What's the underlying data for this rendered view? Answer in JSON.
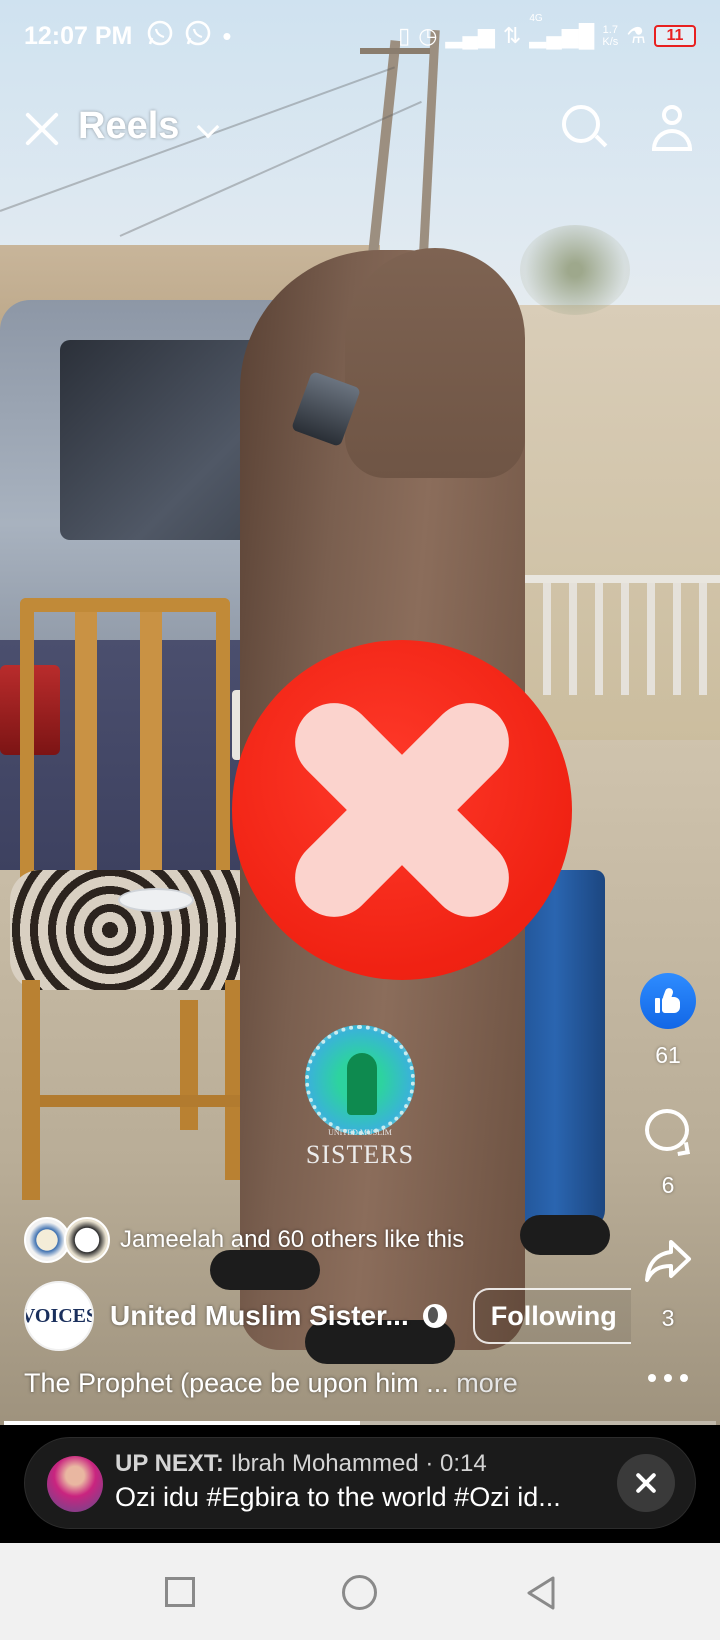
{
  "status_bar": {
    "time": "12:07 PM",
    "network_speed_value": "1.7",
    "network_speed_unit": "K/s",
    "network_type": "4G",
    "battery": "11",
    "icons": [
      "whatsapp-icon",
      "whatsapp-icon",
      "dot-icon",
      "vibrate-icon",
      "alarm-icon",
      "signal-icon",
      "data-arrows-icon",
      "signal-4g-icon",
      "flask-icon",
      "battery-low-icon"
    ]
  },
  "top_bar": {
    "title": "Reels",
    "icons": [
      "close-icon",
      "chevron-down-icon",
      "search-icon",
      "profile-icon"
    ]
  },
  "watermark": {
    "text": "SISTERS",
    "small_text": "UNITED MUSLIM"
  },
  "actions": {
    "likes": "61",
    "comments": "6",
    "shares": "3",
    "like_color": "#1877f2"
  },
  "post": {
    "likes_summary": "Jameelah and 60 others like this",
    "author": "United Muslim Sister...",
    "author_avatar_text": "VOICES",
    "follow_label": "Following",
    "caption": "The Prophet (peace be upon him ...",
    "more_label": "more",
    "progress_fraction": 0.5
  },
  "up_next": {
    "label": "UP NEXT:",
    "author": "Ibrah Mohammed",
    "duration": "0:14",
    "title": "Ozi idu #Egbira to the world #Ozi id..."
  },
  "overlay": {
    "red_x_color": "#f02213"
  }
}
